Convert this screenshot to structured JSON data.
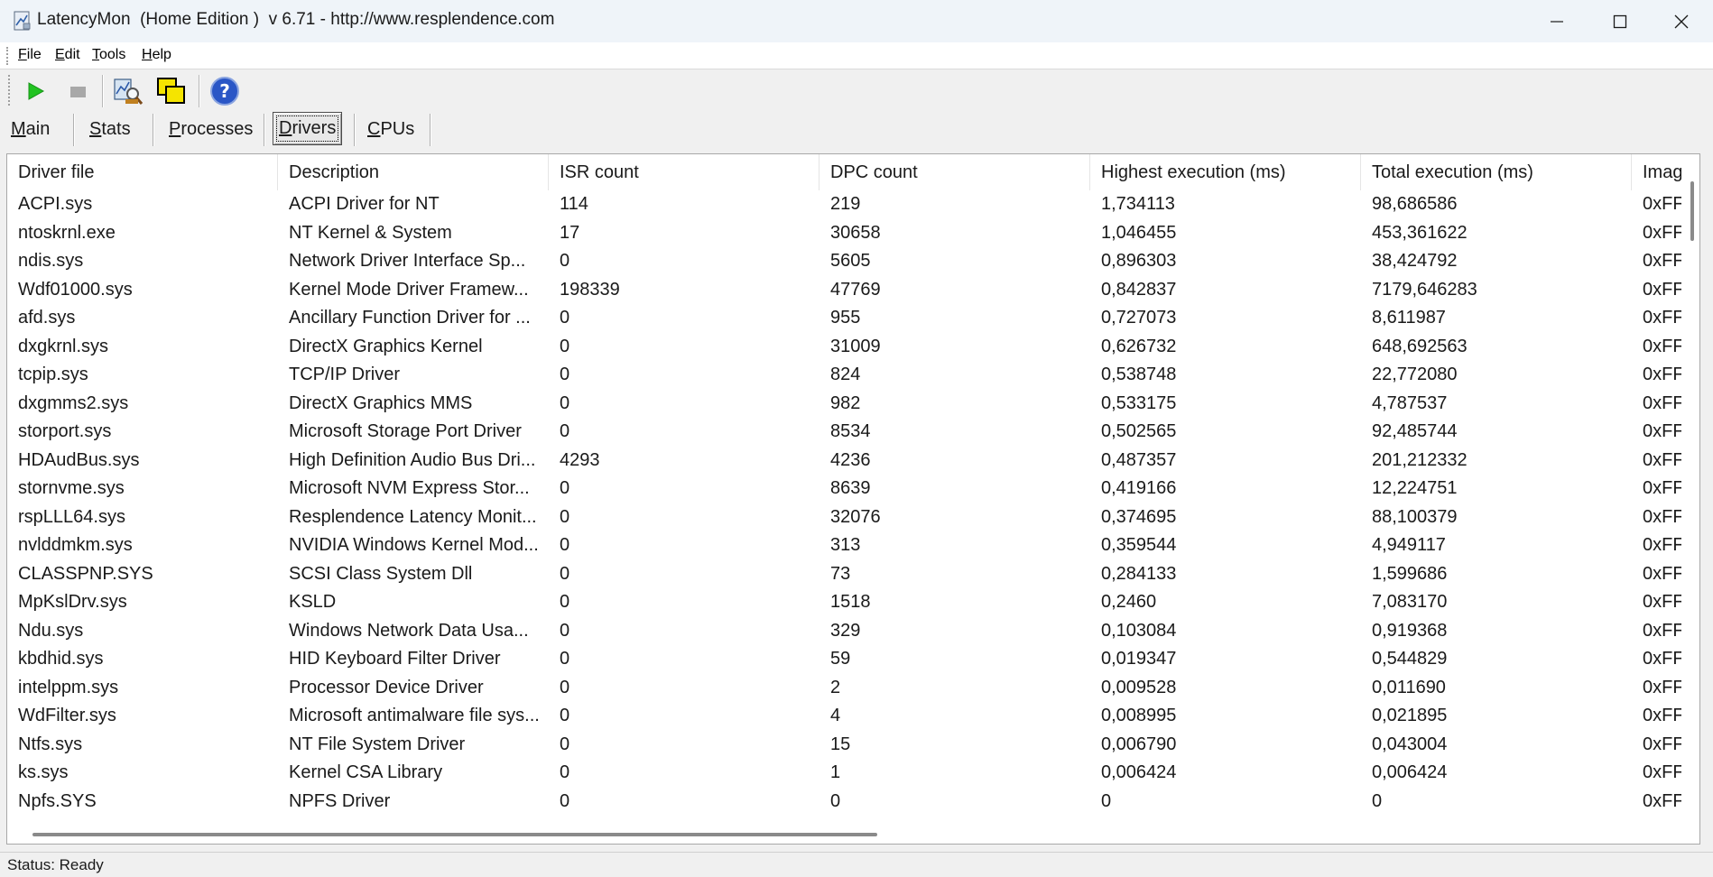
{
  "window": {
    "title": "LatencyMon  (Home Edition )  v 6.71 - http://www.resplendence.com"
  },
  "menu": [
    {
      "u": "F",
      "rest": "ile"
    },
    {
      "u": "E",
      "rest": "dit"
    },
    {
      "u": "T",
      "rest": "ools"
    },
    {
      "u": "H",
      "rest": "elp"
    }
  ],
  "toolbar": {
    "icons": [
      "play-icon",
      "stop-icon",
      "analyze-icon",
      "windows-icon",
      "help-icon"
    ],
    "colors": {
      "play": "#22c322",
      "help": "#2a56c6"
    }
  },
  "tabs": [
    {
      "u": "M",
      "rest": "ain"
    },
    {
      "u": "S",
      "rest": "tats"
    },
    {
      "u": "P",
      "rest": "rocesses"
    },
    {
      "u": "D",
      "rest": "rivers"
    },
    {
      "u": "C",
      "rest": "PUs"
    }
  ],
  "active_tab": "Drivers",
  "table": {
    "columns": [
      "Driver file",
      "Description",
      "ISR count",
      "DPC count",
      "Highest execution (ms)",
      "Total execution (ms)",
      "Imag"
    ],
    "rows": [
      [
        "ACPI.sys",
        "ACPI Driver for NT",
        "114",
        "219",
        "1,734113",
        "98,686586",
        "0xFF"
      ],
      [
        "ntoskrnl.exe",
        "NT Kernel & System",
        "17",
        "30658",
        "1,046455",
        "453,361622",
        "0xFF"
      ],
      [
        "ndis.sys",
        "Network Driver Interface Sp...",
        "0",
        "5605",
        "0,896303",
        "38,424792",
        "0xFF"
      ],
      [
        "Wdf01000.sys",
        "Kernel Mode Driver Framew...",
        "198339",
        "47769",
        "0,842837",
        "7179,646283",
        "0xFF"
      ],
      [
        "afd.sys",
        "Ancillary Function Driver for ...",
        "0",
        "955",
        "0,727073",
        "8,611987",
        "0xFF"
      ],
      [
        "dxgkrnl.sys",
        "DirectX Graphics Kernel",
        "0",
        "31009",
        "0,626732",
        "648,692563",
        "0xFF"
      ],
      [
        "tcpip.sys",
        "TCP/IP Driver",
        "0",
        "824",
        "0,538748",
        "22,772080",
        "0xFF"
      ],
      [
        "dxgmms2.sys",
        "DirectX Graphics MMS",
        "0",
        "982",
        "0,533175",
        "4,787537",
        "0xFF"
      ],
      [
        "storport.sys",
        "Microsoft Storage Port Driver",
        "0",
        "8534",
        "0,502565",
        "92,485744",
        "0xFF"
      ],
      [
        "HDAudBus.sys",
        "High Definition Audio Bus Dri...",
        "4293",
        "4236",
        "0,487357",
        "201,212332",
        "0xFF"
      ],
      [
        "stornvme.sys",
        "Microsoft NVM Express Stor...",
        "0",
        "8639",
        "0,419166",
        "12,224751",
        "0xFF"
      ],
      [
        "rspLLL64.sys",
        "Resplendence Latency Monit...",
        "0",
        "32076",
        "0,374695",
        "88,100379",
        "0xFF"
      ],
      [
        "nvlddmkm.sys",
        "NVIDIA Windows Kernel Mod...",
        "0",
        "313",
        "0,359544",
        "4,949117",
        "0xFF"
      ],
      [
        "CLASSPNP.SYS",
        "SCSI Class System Dll",
        "0",
        "73",
        "0,284133",
        "1,599686",
        "0xFF"
      ],
      [
        "MpKslDrv.sys",
        "KSLD",
        "0",
        "1518",
        "0,2460",
        "7,083170",
        "0xFF"
      ],
      [
        "Ndu.sys",
        "Windows Network Data Usa...",
        "0",
        "329",
        "0,103084",
        "0,919368",
        "0xFF"
      ],
      [
        "kbdhid.sys",
        "HID Keyboard Filter Driver",
        "0",
        "59",
        "0,019347",
        "0,544829",
        "0xFF"
      ],
      [
        "intelppm.sys",
        "Processor Device Driver",
        "0",
        "2",
        "0,009528",
        "0,011690",
        "0xFF"
      ],
      [
        "WdFilter.sys",
        "Microsoft antimalware file sys...",
        "0",
        "4",
        "0,008995",
        "0,021895",
        "0xFF"
      ],
      [
        "Ntfs.sys",
        "NT File System Driver",
        "0",
        "15",
        "0,006790",
        "0,043004",
        "0xFF"
      ],
      [
        "ks.sys",
        "Kernel CSA Library",
        "0",
        "1",
        "0,006424",
        "0,006424",
        "0xFF"
      ],
      [
        "Npfs.SYS",
        "NPFS Driver",
        "0",
        "0",
        "0",
        "0",
        "0xFF"
      ]
    ]
  },
  "status": {
    "text": "Status: Ready"
  }
}
